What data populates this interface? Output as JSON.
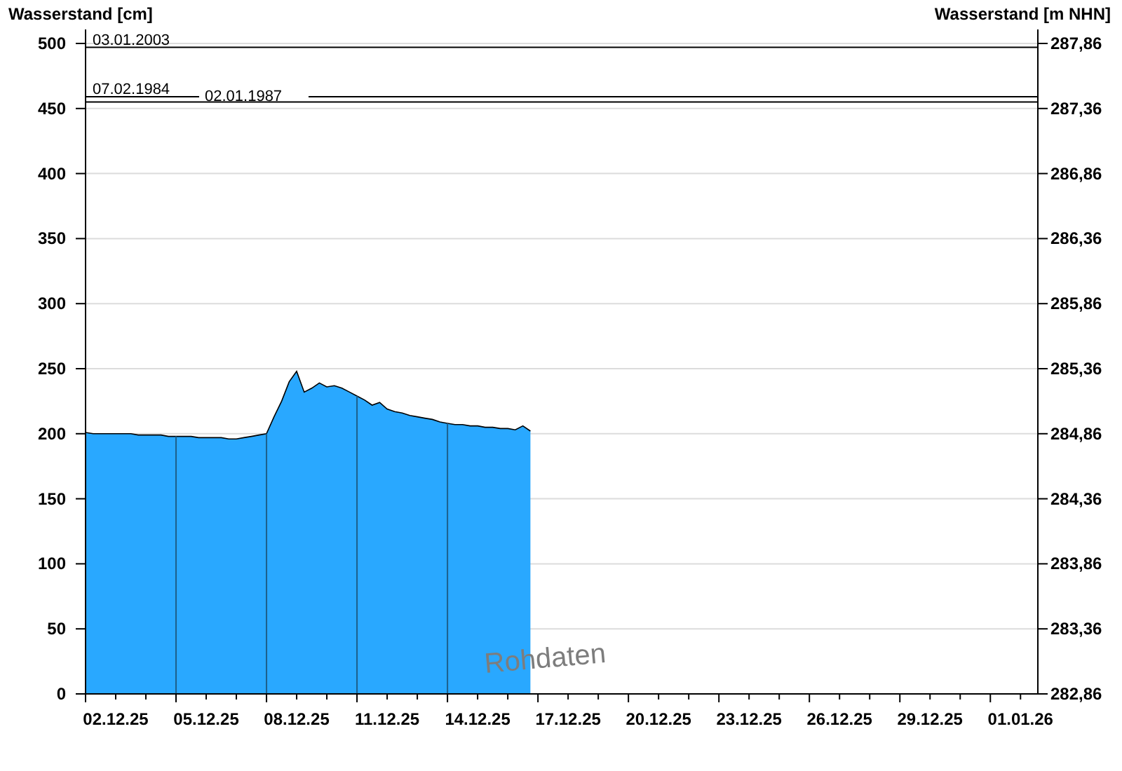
{
  "chart_data": {
    "type": "area",
    "ylabel": "Wasserstand [cm]",
    "y2label": "Wasserstand [m NHN]",
    "categories": [
      null,
      null,
      null,
      null,
      "02.12.25",
      null,
      null,
      null,
      null,
      null,
      null,
      null,
      null,
      null,
      null,
      null,
      "05.12.25",
      null,
      null,
      null,
      null,
      null,
      null,
      null,
      null,
      null,
      null,
      null,
      "08.12.25",
      null,
      null,
      null,
      null,
      null,
      null,
      null,
      null,
      null,
      null,
      null,
      "11.12.25",
      null,
      null,
      null,
      null,
      null,
      null,
      null,
      null,
      null,
      null,
      null,
      "14.12.25",
      null,
      null,
      null,
      null,
      null,
      null,
      null,
      null,
      null,
      null,
      null,
      "17.12.25",
      null,
      null,
      null,
      null,
      null,
      null,
      null,
      null,
      null,
      null,
      null,
      "20.12.25",
      null,
      null,
      null,
      null,
      null,
      null,
      null,
      null,
      null,
      null,
      null,
      "23.12.25",
      null,
      null,
      null,
      null,
      null,
      null,
      null,
      null,
      null,
      null,
      null,
      "26.12.25",
      null,
      null,
      null,
      null,
      null,
      null,
      null,
      null,
      null,
      null,
      null,
      "29.12.25",
      null,
      null,
      null,
      null,
      null,
      null,
      null,
      null,
      null,
      null,
      null,
      "01.01.26",
      null,
      null
    ],
    "series": [
      {
        "color": "#29a8ff",
        "values": [
          201,
          200,
          200,
          200,
          200,
          200,
          200,
          199,
          199,
          199,
          199,
          198,
          198,
          198,
          198,
          197,
          197,
          197,
          197,
          196,
          196,
          197,
          198,
          199,
          200,
          213,
          225,
          240,
          248,
          232,
          235,
          239,
          236,
          237,
          235,
          232,
          229,
          226,
          222,
          224,
          219,
          217,
          216,
          214,
          213,
          212,
          211,
          209,
          208,
          207,
          207,
          206,
          206,
          205,
          205,
          204,
          204,
          203,
          206,
          202,
          null,
          null,
          null,
          null,
          null,
          null,
          null,
          null,
          null,
          null,
          null,
          null,
          null,
          null,
          null,
          null,
          null,
          null,
          null,
          null,
          null,
          null,
          null,
          null,
          null,
          null,
          null,
          null,
          null,
          null,
          null,
          null,
          null,
          null,
          null,
          null,
          null,
          null,
          null,
          null,
          null,
          null,
          null,
          null,
          null,
          null,
          null,
          null,
          null,
          null,
          null,
          null,
          null,
          null,
          null,
          null,
          null,
          null,
          null,
          null,
          null,
          null,
          null,
          null,
          null,
          null,
          null
        ]
      }
    ],
    "ylim": [
      0,
      500
    ],
    "grid": true,
    "y2lim": [
      282.86,
      287.86
    ],
    "yticks": [
      0,
      50,
      100,
      150,
      200,
      250,
      300,
      350,
      400,
      450,
      500
    ],
    "y2ticks": [
      {
        "value": 282.86,
        "label": "282,86"
      },
      {
        "value": 283.36,
        "label": "283,36"
      },
      {
        "value": 283.86,
        "label": "283,86"
      },
      {
        "value": 284.36,
        "label": "284,36"
      },
      {
        "value": 284.86,
        "label": "284,86"
      },
      {
        "value": 285.36,
        "label": "285,36"
      },
      {
        "value": 285.86,
        "label": "285,86"
      },
      {
        "value": 286.36,
        "label": "286,36"
      },
      {
        "value": 286.86,
        "label": "286,86"
      },
      {
        "value": 287.36,
        "label": "287,36"
      },
      {
        "value": 287.86,
        "label": "287,86"
      }
    ],
    "ref_lines": [
      {
        "axis": "y",
        "value": 497,
        "label": "03.01.2003"
      },
      {
        "axis": "y",
        "value": 459,
        "label": "07.02.1984"
      },
      {
        "axis": "y",
        "value": 455,
        "label": "02.01.1987"
      }
    ],
    "annotations": [
      "Rohdaten"
    ]
  }
}
